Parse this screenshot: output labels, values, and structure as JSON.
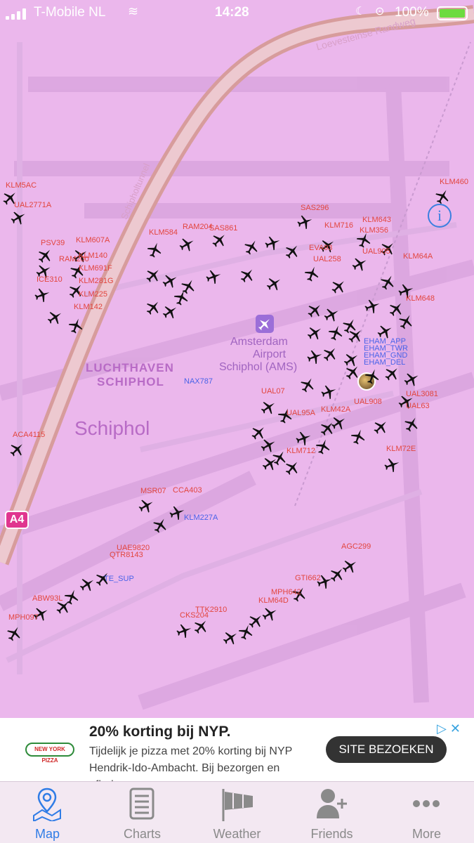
{
  "status_bar": {
    "carrier": "T-Mobile NL",
    "time": "14:28",
    "battery": "100%"
  },
  "map": {
    "road_labels": [
      "Loevesteinse Randweg",
      "Schipholtunnel"
    ],
    "place_labels": {
      "airport_line1": "Amsterdam",
      "airport_line2": "Airport",
      "airport_line3": "Schiphol (AMS)",
      "area_line1": "LUCHTHAVEN",
      "area_line2": "SCHIPHOL",
      "town": "Schiphol"
    },
    "road_badge": "A4",
    "flights": [
      "KLM5AC",
      "UAL2771A",
      "KLM460",
      "SAS296",
      "PSV39",
      "KLM607A",
      "KLM584",
      "RAM204",
      "SAS861",
      "KLM643",
      "KLM716",
      "KLM356",
      "RAM200",
      "KLM140",
      "KLM691F",
      "KLM281G",
      "ICE310",
      "KLM225",
      "KLM142",
      "UAL905",
      "KLM64A",
      "KLM648",
      "UAL258",
      "EVA93",
      "NAX787",
      "ACA4115",
      "UAL07",
      "UAL95A",
      "KLM42A",
      "UAL908",
      "KLM712",
      "KLM72E",
      "UAL3081",
      "UAL63",
      "KLM227A",
      "UAE9820",
      "QTR8143",
      "AGC299",
      "GTI662",
      "MPH642",
      "KLM64D",
      "TTK2910",
      "CKS204",
      "ABW93L",
      "MPH097",
      "CCA403",
      "MSR07"
    ],
    "ground_labels": [
      "EHAM_APP",
      "EHAM_TWR",
      "EHAM_GND",
      "EHAM_DEL",
      "TE_SUP"
    ]
  },
  "ad": {
    "logo_text": "NEW YORK PIZZA",
    "title": "20% korting bij NYP.",
    "body": "Tijdelijk je pizza met 20% korting bij NYP Hendrik-Ido-Ambacht. Bij bezorgen en afhalen.",
    "cta": "SITE BEZOEKEN"
  },
  "tabs": [
    {
      "label": "Map",
      "icon": "map-pin-icon",
      "active": true
    },
    {
      "label": "Charts",
      "icon": "document-icon",
      "active": false
    },
    {
      "label": "Weather",
      "icon": "windsock-icon",
      "active": false
    },
    {
      "label": "Friends",
      "icon": "add-user-icon",
      "active": false
    },
    {
      "label": "More",
      "icon": "ellipsis-icon",
      "active": false
    }
  ],
  "colors": {
    "map_bg": "#ebb7ec",
    "flight_label": "#e2453e",
    "atc_label": "#4a63e8",
    "tab_active": "#2f7ce6"
  }
}
